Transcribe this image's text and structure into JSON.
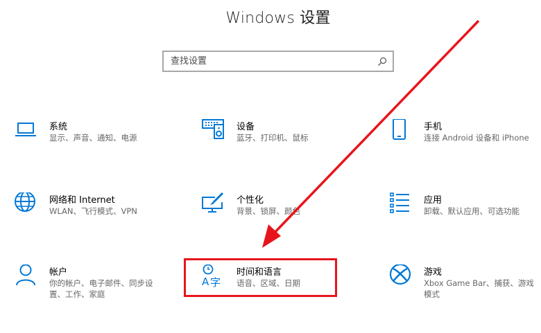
{
  "page": {
    "title": "Windows 设置"
  },
  "search": {
    "placeholder": "查找设置"
  },
  "colors": {
    "accent": "#0078d7",
    "annotation": "#e8141c"
  },
  "tiles": [
    {
      "id": "system",
      "icon": "laptop-icon",
      "title": "系统",
      "desc": "显示、声音、通知、电源"
    },
    {
      "id": "devices",
      "icon": "keyboard-speaker-icon",
      "title": "设备",
      "desc": "蓝牙、打印机、鼠标"
    },
    {
      "id": "phone",
      "icon": "phone-icon",
      "title": "手机",
      "desc": "连接 Android 设备和 iPhone"
    },
    {
      "id": "network",
      "icon": "globe-icon",
      "title": "网络和 Internet",
      "desc": "WLAN、飞行模式、VPN"
    },
    {
      "id": "personalization",
      "icon": "paint-screen-icon",
      "title": "个性化",
      "desc": "背景、锁屏、颜色"
    },
    {
      "id": "apps",
      "icon": "app-list-icon",
      "title": "应用",
      "desc": "卸载、默认应用、可选功能"
    },
    {
      "id": "accounts",
      "icon": "person-icon",
      "title": "帐户",
      "desc": "你的帐户、电子邮件、同步设置、工作、家庭"
    },
    {
      "id": "time-language",
      "icon": "time-language-icon",
      "title": "时间和语言",
      "desc": "语音、区域、日期"
    },
    {
      "id": "gaming",
      "icon": "xbox-icon",
      "title": "游戏",
      "desc": "Xbox Game Bar、捕获、游戏模式"
    }
  ]
}
